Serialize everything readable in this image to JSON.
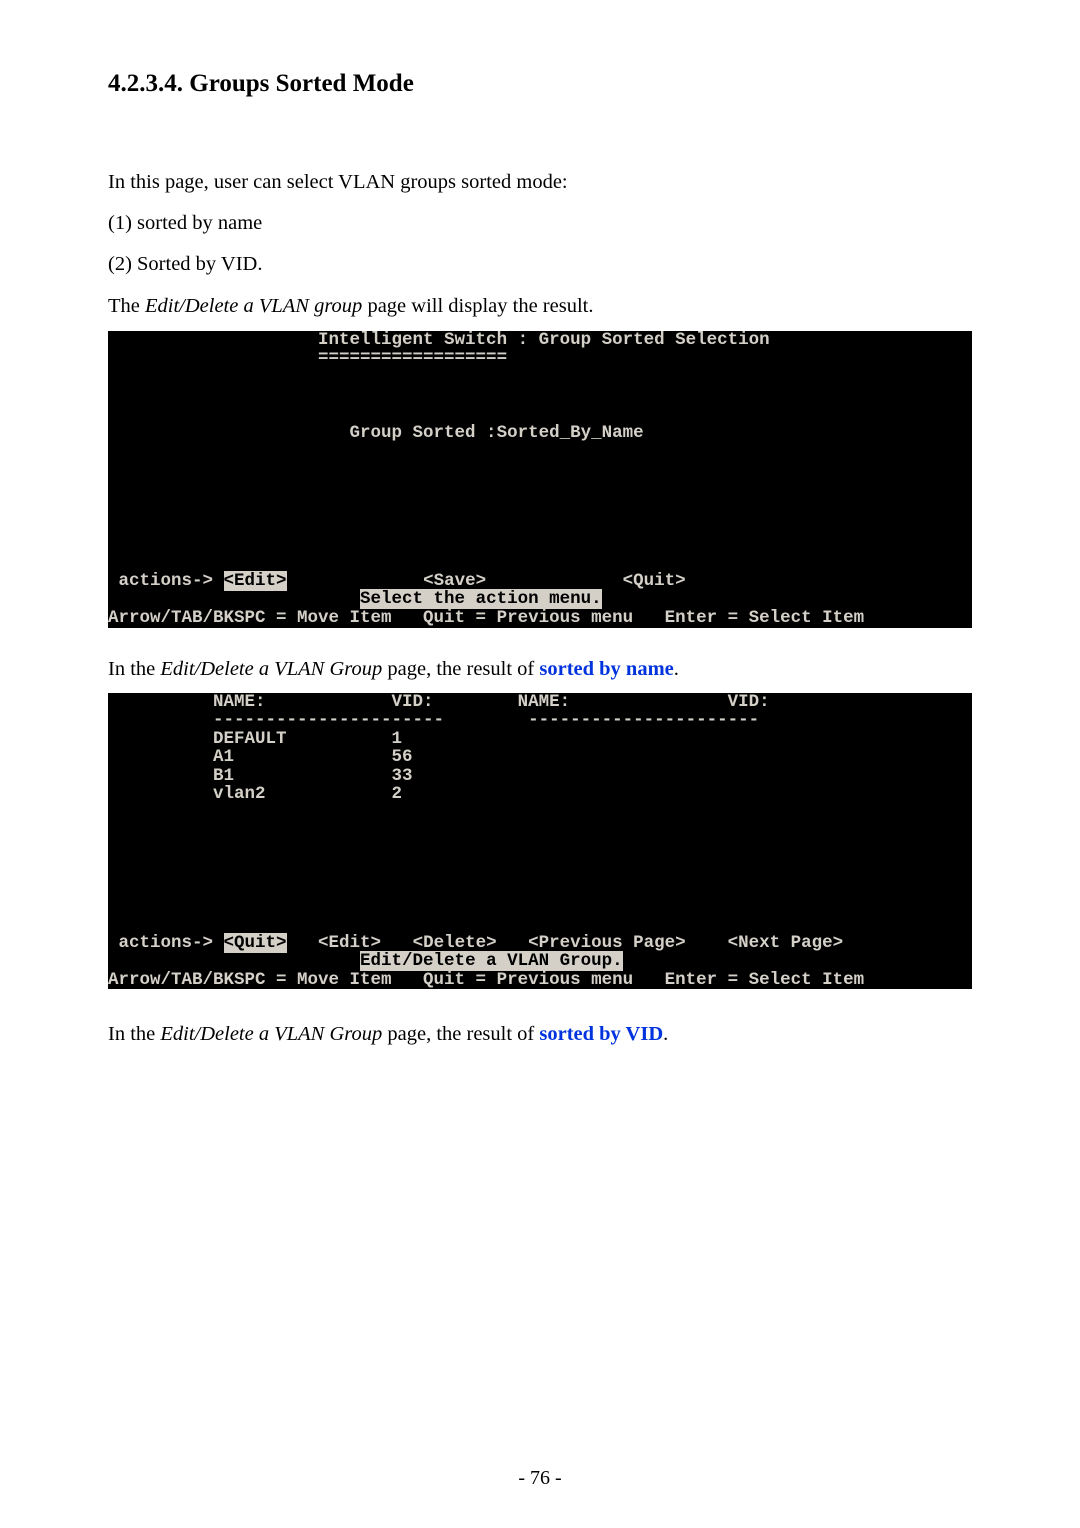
{
  "heading": "4.2.3.4. Groups Sorted Mode",
  "intro_line": "In this page, user can select VLAN groups sorted mode:",
  "option1": "(1) sorted by name",
  "option2": "(2) Sorted by VID.",
  "the_word": "The",
  "page_name_italic": "Edit/Delete a VLAN group",
  "intro_tail": " page will display the result.",
  "terminal1": {
    "title_left": "                    Intelligent Switch : Group Sorted Selection",
    "title_underline": "                    ==================",
    "group_line": "                       Group Sorted :Sorted_By_Name",
    "actions_pre": " actions-> ",
    "edit_inv": "<Edit>",
    "actions_mid": "             <Save>             <Quit>",
    "status_pre": "                        ",
    "status_inv": "Select the action menu.",
    "footer": "Arrow/TAB/BKSPC = Move Item   Quit = Previous menu   Enter = Select Item "
  },
  "result1_pre": "In the ",
  "result1_italic": "Edit/Delete a VLAN Group",
  "result1_mid": " page, the result of ",
  "result1_keyword": "sorted by name",
  "result1_tail": ".",
  "terminal2": {
    "header": "          NAME:            VID:        NAME:               VID:",
    "divider": "          ----------------------        ----------------------",
    "row1": "          DEFAULT          1",
    "row2": "          A1               56",
    "row3": "          B1               33",
    "row4": "          vlan2            2",
    "actions_pre": " actions-> ",
    "quit_inv": "<Quit>",
    "actions_rest": "   <Edit>   <Delete>   <Previous Page>    <Next Page>",
    "status_pre": "                        ",
    "status_inv": "Edit/Delete a VLAN Group.",
    "footer": "Arrow/TAB/BKSPC = Move Item   Quit = Previous menu   Enter = Select Item "
  },
  "result2_pre": "In the ",
  "result2_italic": "Edit/Delete a VLAN Group",
  "result2_mid": " page, the result of ",
  "result2_keyword": "sorted by VID",
  "result2_tail": ".",
  "page_number": "- 76 -"
}
